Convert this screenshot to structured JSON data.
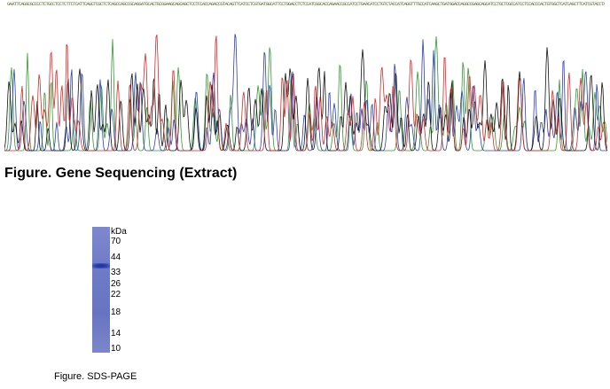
{
  "sequence_strip": "GAATTCAGGCGCCCCTCTGCCTCCTCTTCTCATTCAGCTCGCTCTCAGCCAGCCGCAGGATGCACTGCGGAAGCAGCAGCTCCTCCACCAGACCGTACAGTTCATCCTCGTGATGGCATTCCTGGACCTCTCCATCGGCACCAGAACCGCCATCCTGAACATCCTGTCTACCATCAGGTTTGCCATCAAGCTGATGGACCAGGCCGAGCAGCATCCTGCTCGCCATCCTCCACCCACTGTGGCTCATCAGCTTCATCGTACCTAATGGTAG",
  "gene_caption": "Figure. Gene Sequencing (Extract)",
  "gel": {
    "unit": "kDa",
    "markers": [
      "70",
      "44",
      "33",
      "26",
      "22",
      "18",
      "14",
      "10"
    ]
  },
  "sds_caption": "Figure. SDS-PAGE",
  "colors": {
    "trace_a": "#2f9a2f",
    "trace_c": "#2b3fb0",
    "trace_g": "#111111",
    "trace_t": "#d42a2a",
    "gel": "#6f7cc6",
    "band": "#1a2f9e"
  }
}
